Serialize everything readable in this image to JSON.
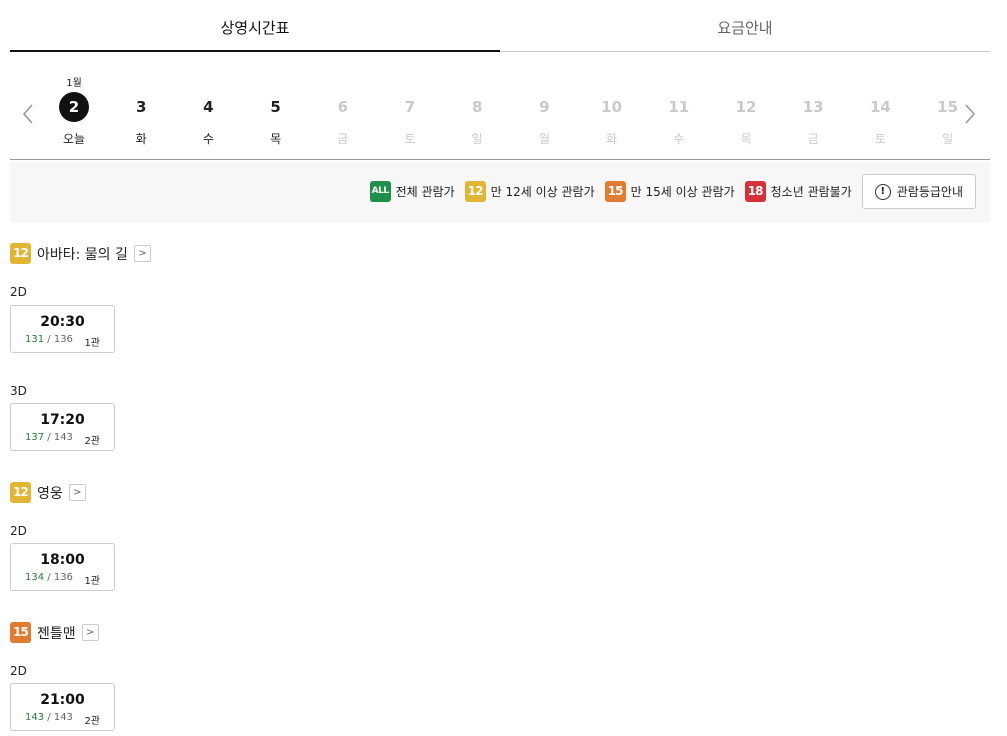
{
  "tabs": [
    "상영시간표",
    "요금안내"
  ],
  "calendar": {
    "month": "1월",
    "days": [
      {
        "num": "2",
        "dow": "오늘",
        "state": "active"
      },
      {
        "num": "3",
        "dow": "화",
        "state": "enabled"
      },
      {
        "num": "4",
        "dow": "수",
        "state": "enabled"
      },
      {
        "num": "5",
        "dow": "목",
        "state": "enabled"
      },
      {
        "num": "6",
        "dow": "금",
        "state": "disabled"
      },
      {
        "num": "7",
        "dow": "토",
        "state": "disabled"
      },
      {
        "num": "8",
        "dow": "일",
        "state": "disabled"
      },
      {
        "num": "9",
        "dow": "월",
        "state": "disabled"
      },
      {
        "num": "10",
        "dow": "화",
        "state": "disabled"
      },
      {
        "num": "11",
        "dow": "수",
        "state": "disabled"
      },
      {
        "num": "12",
        "dow": "목",
        "state": "disabled"
      },
      {
        "num": "13",
        "dow": "금",
        "state": "disabled"
      },
      {
        "num": "14",
        "dow": "토",
        "state": "disabled"
      },
      {
        "num": "15",
        "dow": "일",
        "state": "disabled"
      }
    ]
  },
  "legend": {
    "items": [
      {
        "badge": "ALL",
        "label": "전체 관람가",
        "color": "#1f8f4a"
      },
      {
        "badge": "12",
        "label": "만 12세 이상 관람가",
        "color": "#e2b534"
      },
      {
        "badge": "15",
        "label": "만 15세 이상 관람가",
        "color": "#e07b30"
      },
      {
        "badge": "18",
        "label": "청소년 관람불가",
        "color": "#d6303b"
      }
    ],
    "guide_button": "관람등급안내"
  },
  "movies": [
    {
      "rating": "12",
      "title": "아바타: 물의 길",
      "formats": [
        {
          "format": "2D",
          "showtimes": [
            {
              "time": "20:30",
              "remaining": "131",
              "total": "136",
              "hall": "1관"
            }
          ]
        },
        {
          "format": "3D",
          "showtimes": [
            {
              "time": "17:20",
              "remaining": "137",
              "total": "143",
              "hall": "2관"
            }
          ]
        }
      ]
    },
    {
      "rating": "12",
      "title": "영웅",
      "formats": [
        {
          "format": "2D",
          "showtimes": [
            {
              "time": "18:00",
              "remaining": "134",
              "total": "136",
              "hall": "1관"
            }
          ]
        }
      ]
    },
    {
      "rating": "15",
      "title": "젠틀맨",
      "formats": [
        {
          "format": "2D",
          "showtimes": [
            {
              "time": "21:00",
              "remaining": "143",
              "total": "143",
              "hall": "2관"
            }
          ]
        }
      ]
    }
  ]
}
